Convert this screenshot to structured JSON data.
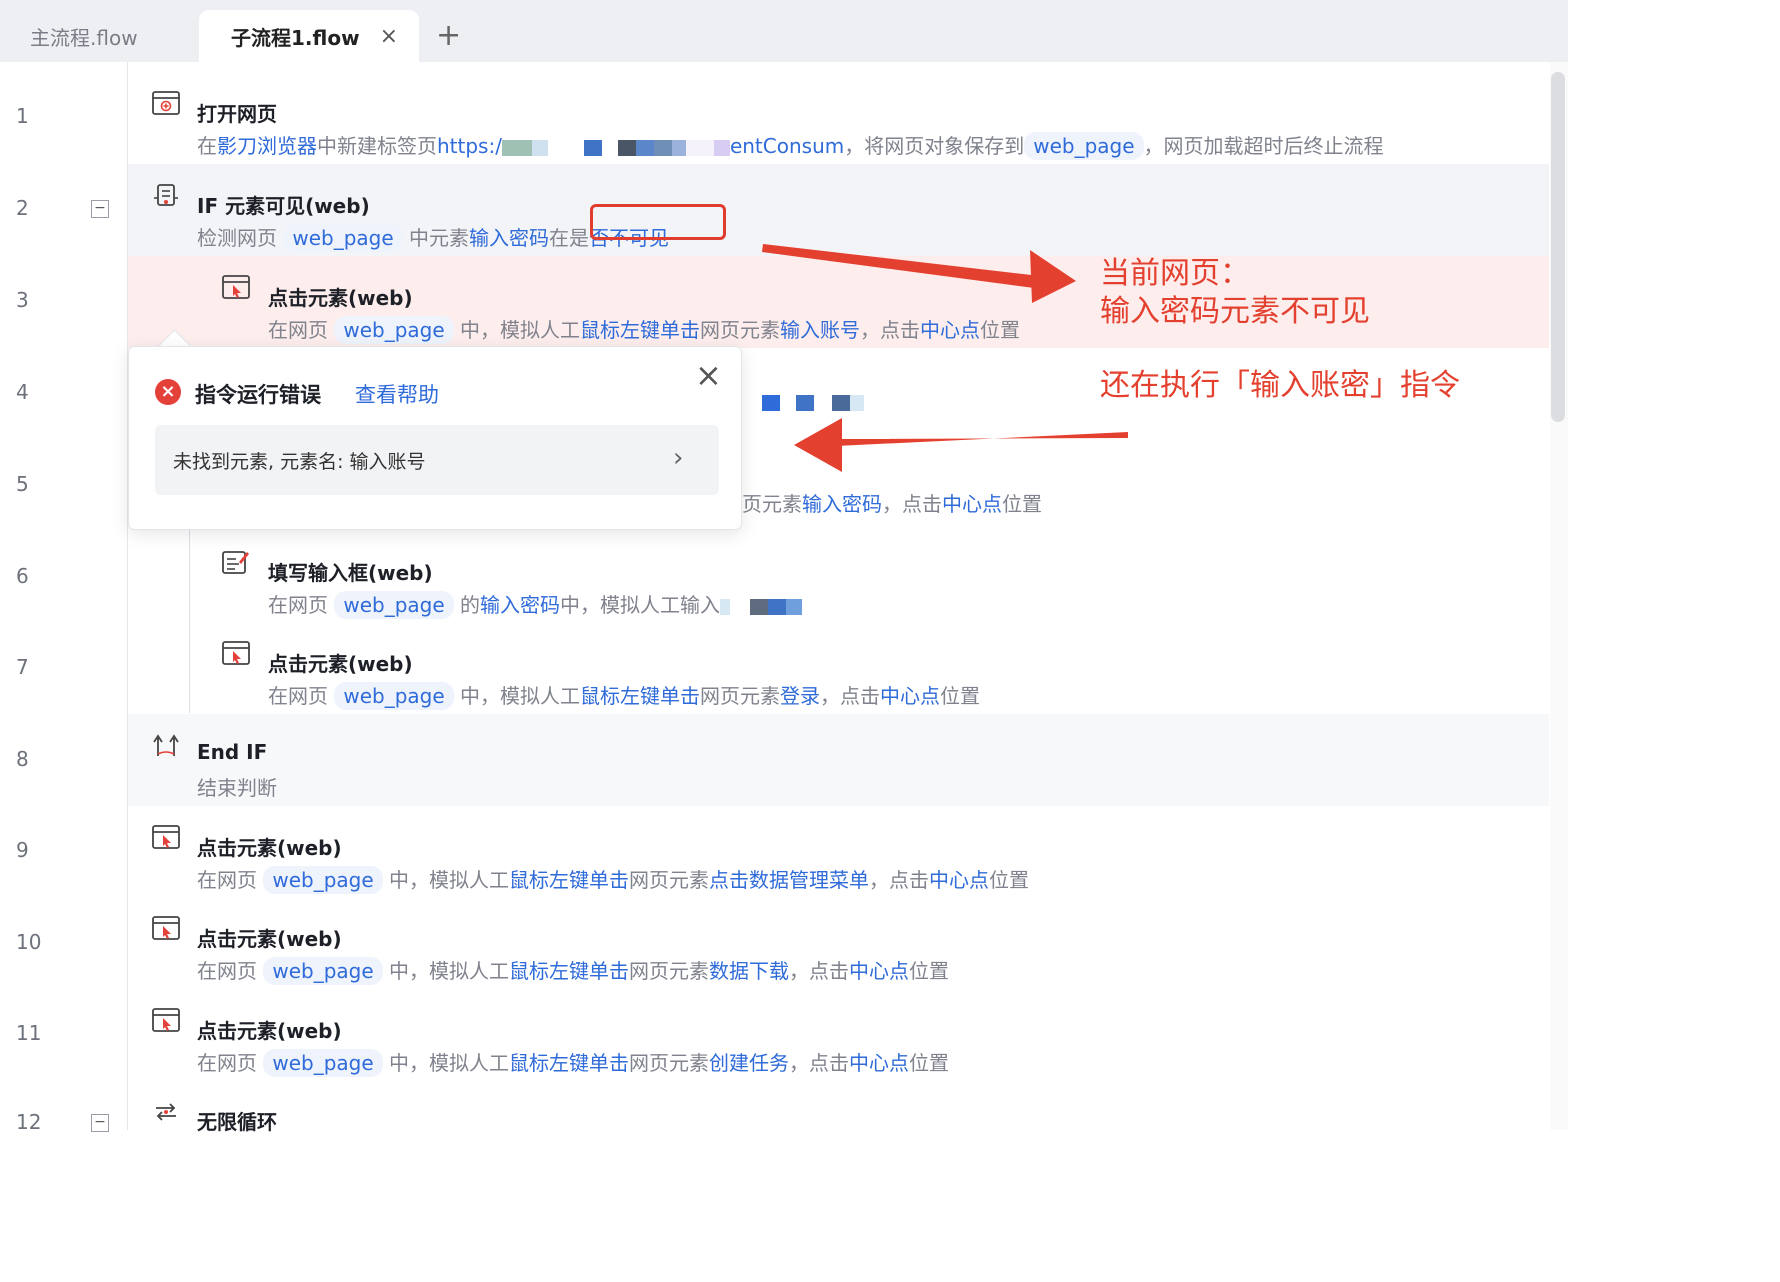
{
  "tabs": [
    {
      "label": "主流程.flow"
    },
    {
      "label": "子流程1.flow",
      "close": "×"
    }
  ],
  "add_tab": "+",
  "line_numbers": [
    "1",
    "2",
    "3",
    "4",
    "5",
    "6",
    "7",
    "8",
    "9",
    "10",
    "11",
    "12"
  ],
  "rows": {
    "r1": {
      "title": "打开网页",
      "d_prefix": "在",
      "d_browser": "影刀浏览器",
      "d_mid": "中新建标签页",
      "d_url_start": "https:/",
      "d_url_end": "entConsum",
      "d_save": "，将网页对象保存到",
      "d_var": "web_page",
      "d_suffix": "，网页加载超时后终止流程"
    },
    "r2": {
      "title": "IF 元素可见(web)",
      "d_prefix": "检测网页",
      "d_var": "web_page",
      "d_mid": "中元素",
      "d_elem": "输入密码",
      "d_mid2": "在是",
      "d_state": "否不可见"
    },
    "r3": {
      "title": "点击元素(web)",
      "d_prefix": "在网页",
      "d_var": "web_page",
      "d_mid": "中，模拟人工",
      "d_action": "鼠标左键单击",
      "d_mid2": "网页元素",
      "d_elem": "输入账号",
      "d_mid3": "，点击",
      "d_pos": "中心点",
      "d_suffix": "位置"
    },
    "r5": {
      "d_pre": "页元素",
      "d_elem": "输入密码",
      "d_mid3": "，点击",
      "d_pos": "中心点",
      "d_suffix": "位置"
    },
    "r6": {
      "title": "填写输入框(web)",
      "d_prefix": "在网页",
      "d_var": "web_page",
      "d_mid": "的",
      "d_elem": "输入密码",
      "d_mid2": "中，模拟人工输入"
    },
    "r7": {
      "title": "点击元素(web)",
      "d_prefix": "在网页",
      "d_var": "web_page",
      "d_mid": "中，模拟人工",
      "d_action": "鼠标左键单击",
      "d_mid2": "网页元素",
      "d_elem": "登录",
      "d_mid3": "，点击",
      "d_pos": "中心点",
      "d_suffix": "位置"
    },
    "r8": {
      "title": "End IF",
      "desc": "结束判断"
    },
    "r9": {
      "title": "点击元素(web)",
      "d_prefix": "在网页",
      "d_var": "web_page",
      "d_mid": "中，模拟人工",
      "d_action": "鼠标左键单击",
      "d_mid2": "网页元素",
      "d_elem": "点击数据管理菜单",
      "d_mid3": "，点击",
      "d_pos": "中心点",
      "d_suffix": "位置"
    },
    "r10": {
      "title": "点击元素(web)",
      "d_prefix": "在网页",
      "d_var": "web_page",
      "d_mid": "中，模拟人工",
      "d_action": "鼠标左键单击",
      "d_mid2": "网页元素",
      "d_elem": "数据下载",
      "d_mid3": "，点击",
      "d_pos": "中心点",
      "d_suffix": "位置"
    },
    "r11": {
      "title": "点击元素(web)",
      "d_prefix": "在网页",
      "d_var": "web_page",
      "d_mid": "中，模拟人工",
      "d_action": "鼠标左键单击",
      "d_mid2": "网页元素",
      "d_elem": "创建任务",
      "d_mid3": "，点击",
      "d_pos": "中心点",
      "d_suffix": "位置"
    },
    "r12": {
      "title": "无限循环"
    }
  },
  "fold_symbol": "−",
  "popup": {
    "error_icon": "×",
    "title": "指令运行错误",
    "help": "查看帮助",
    "close": "×",
    "message": "未找到元素, 元素名: 输入账号",
    "chevron": "›"
  },
  "annotations": {
    "line1": "当前网页：",
    "line2": "输入密码元素不可见",
    "line3": "还在执行「输入账密」指令"
  },
  "colors": {
    "link": "#2f6bd9",
    "annotation": "#e4402f",
    "error_row": "#fdeeed",
    "error_icon": "#e5413b"
  },
  "icons": {
    "open_page": "browser-icon",
    "if_visible": "if-branch-icon",
    "click": "click-icon",
    "fill_input": "edit-icon",
    "end_if": "end-if-icon",
    "loop": "loop-icon"
  }
}
